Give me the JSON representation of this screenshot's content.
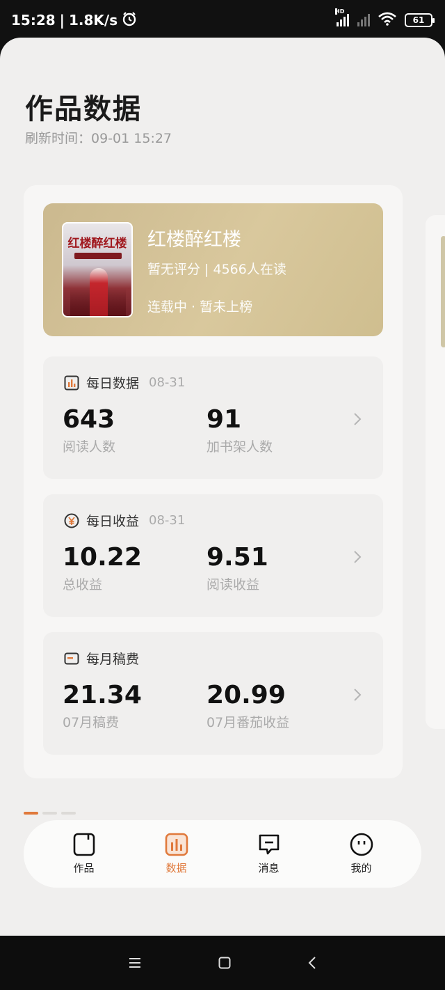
{
  "status": {
    "time": "15:28",
    "speed": "1.8K/s",
    "battery": "61",
    "hd_label": "HD"
  },
  "page": {
    "title": "作品数据",
    "refresh_label": "刷新时间：",
    "refresh_time": "09-01 15:27"
  },
  "book": {
    "name": "红楼醉红楼",
    "rating_text": "暂无评分 | 4566人在读",
    "status_text": "连载中 · 暂未上榜",
    "cover_title": "红楼醉红楼"
  },
  "daily_data": {
    "title": "每日数据",
    "date": "08-31",
    "metrics": [
      {
        "value": "643",
        "label": "阅读人数"
      },
      {
        "value": "91",
        "label": "加书架人数"
      }
    ]
  },
  "daily_income": {
    "title": "每日收益",
    "date": "08-31",
    "metrics": [
      {
        "value": "10.22",
        "label": "总收益"
      },
      {
        "value": "9.51",
        "label": "阅读收益"
      }
    ]
  },
  "monthly_fee": {
    "title": "每月稿费",
    "metrics": [
      {
        "value": "21.34",
        "label": "07月稿费"
      },
      {
        "value": "20.99",
        "label": "07月番茄收益"
      }
    ]
  },
  "tabs": [
    {
      "label": "作品",
      "icon": "book-icon"
    },
    {
      "label": "数据",
      "icon": "chart-icon",
      "active": true
    },
    {
      "label": "消息",
      "icon": "message-icon"
    },
    {
      "label": "我的",
      "icon": "profile-icon"
    }
  ],
  "colors": {
    "accent": "#e0793b",
    "book_card": "#d4c294"
  }
}
